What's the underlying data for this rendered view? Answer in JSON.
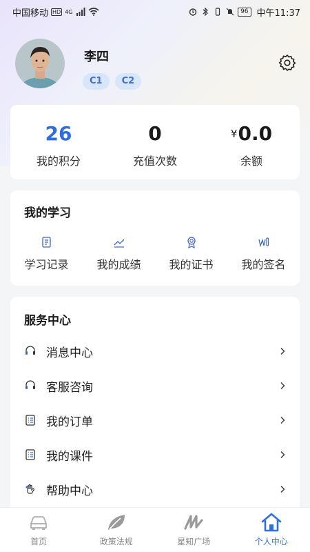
{
  "status_bar": {
    "carrier": "中国移动",
    "hd_badge": "HD",
    "network": "4G",
    "battery": "96",
    "time": "中午11:37"
  },
  "profile": {
    "name": "李四",
    "levels": [
      "C1",
      "C2"
    ],
    "settings_icon": "gear-icon"
  },
  "stats": [
    {
      "value": "26",
      "label": "我的积分"
    },
    {
      "value": "0",
      "label": "充值次数"
    },
    {
      "currency": "¥",
      "value": "0.0",
      "label": "余额"
    }
  ],
  "study": {
    "title": "我的学习",
    "items": [
      {
        "label": "学习记录",
        "icon": "record-icon"
      },
      {
        "label": "我的成绩",
        "icon": "chart-line-icon"
      },
      {
        "label": "我的证书",
        "icon": "medal-icon"
      },
      {
        "label": "我的签名",
        "icon": "signature-icon"
      }
    ]
  },
  "service": {
    "title": "服务中心",
    "items": [
      {
        "label": "消息中心",
        "icon": "headset-icon"
      },
      {
        "label": "客服咨询",
        "icon": "headset-icon"
      },
      {
        "label": "我的订单",
        "icon": "list-icon"
      },
      {
        "label": "我的课件",
        "icon": "list-icon"
      },
      {
        "label": "帮助中心",
        "icon": "hand-icon"
      }
    ]
  },
  "tabbar": {
    "items": [
      {
        "label": "首页",
        "icon": "car-icon",
        "active": false
      },
      {
        "label": "政策法规",
        "icon": "leaf-icon",
        "active": false
      },
      {
        "label": "星知广场",
        "icon": "scribble-icon",
        "active": false
      },
      {
        "label": "个人中心",
        "icon": "home-icon",
        "active": true
      }
    ]
  },
  "colors": {
    "accent": "#2f6de0",
    "chip_bg": "#d8e6fb",
    "chip_text": "#3f6fcf",
    "tab_inactive": "#888888"
  }
}
